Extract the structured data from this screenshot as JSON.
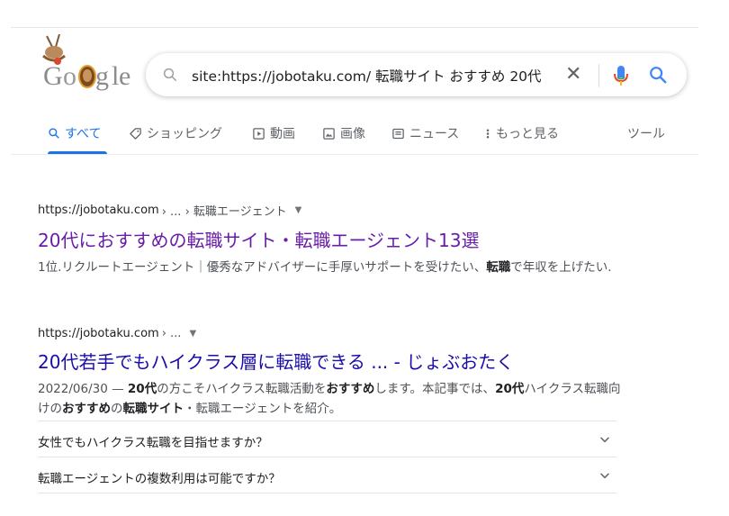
{
  "logo": {
    "text": "Google",
    "letters": [
      "G",
      "o",
      "o",
      "g",
      "l",
      "e"
    ]
  },
  "search": {
    "query": "site:https://jobotaku.com/ 転職サイト おすすめ 20代",
    "clear_glyph": "✕"
  },
  "tabs": [
    {
      "label": "すべて",
      "icon": "search-icon",
      "active": true
    },
    {
      "label": "ショッピング",
      "icon": "tag-icon"
    },
    {
      "label": "動画",
      "icon": "video-icon"
    },
    {
      "label": "画像",
      "icon": "image-icon"
    },
    {
      "label": "ニュース",
      "icon": "news-icon"
    },
    {
      "label": "もっと見る",
      "icon": "more-vert-icon"
    }
  ],
  "tools_label": "ツール",
  "results": [
    {
      "url": "https://jobotaku.com",
      "path": " › ... › 転職エージェント",
      "caret": "▼",
      "title": "20代におすすめの転職サイト・転職エージェント13選",
      "snippet_parts": [
        {
          "text": "1位.リクルートエージェント｜優秀なアドバイザーに手厚いサポートを受けたい、",
          "bold": false
        },
        {
          "text": "転職",
          "bold": true
        },
        {
          "text": "で年収を上げたい.",
          "bold": false
        }
      ]
    },
    {
      "url": "https://jobotaku.com",
      "path": " › ...",
      "caret": "▼",
      "title": "20代若手でもハイクラス層に転職できる ... - じょぶおたく",
      "snippet_parts": [
        {
          "text": "2022/06/30 — ",
          "bold": false
        },
        {
          "text": "20代",
          "bold": true
        },
        {
          "text": "の方こそハイクラス転職活動を",
          "bold": false
        },
        {
          "text": "おすすめ",
          "bold": true
        },
        {
          "text": "します。本記事では、",
          "bold": false
        },
        {
          "text": "20代",
          "bold": true
        },
        {
          "text": "ハイクラス転職向けの",
          "bold": false
        },
        {
          "text": "おすすめ",
          "bold": true
        },
        {
          "text": "の",
          "bold": false
        },
        {
          "text": "転職サイト",
          "bold": true
        },
        {
          "text": "・転職エージェントを紹介。",
          "bold": false
        }
      ]
    }
  ],
  "faqs": [
    {
      "question": "女性でもハイクラス転職を目指せますか？"
    },
    {
      "question": "転職エージェントの複数利用は可能ですか？"
    }
  ],
  "colors": {
    "link_visited": "#681da8",
    "link": "#1a0dab",
    "accent": "#1a73e8"
  }
}
